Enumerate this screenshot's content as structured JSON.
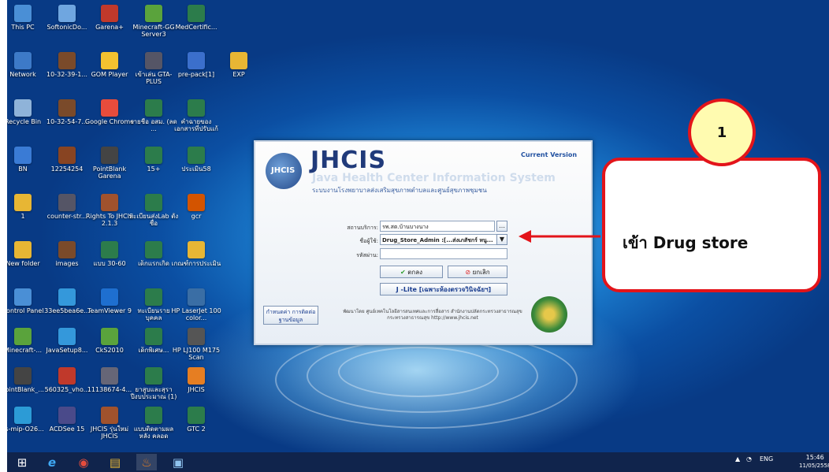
{
  "desktop_icons": [
    {
      "label": "This PC",
      "color": "#4a8fd6"
    },
    {
      "label": "SoftonicDo...",
      "color": "#6fa6e0"
    },
    {
      "label": "Garena+",
      "color": "#c0392b"
    },
    {
      "label": "Minecraft-GG Server3",
      "color": "#5aa33c"
    },
    {
      "label": "MedCertific...",
      "color": "#2c7c4b"
    },
    {
      "label": "Network",
      "color": "#3d7ac8"
    },
    {
      "label": "10-32-39-1...",
      "color": "#7a4a2a"
    },
    {
      "label": "GOM Player",
      "color": "#f2c230"
    },
    {
      "label": "เข้าเล่น GTA-PLUS",
      "color": "#556"
    },
    {
      "label": "pre-pack[1]",
      "color": "#3b6fcc"
    },
    {
      "label": "EXP",
      "color": "#e7b634"
    },
    {
      "label": "Recycle Bin",
      "color": "#8fb3d9"
    },
    {
      "label": "10-32-54-7...",
      "color": "#7a4a2a"
    },
    {
      "label": "Google Chrome",
      "color": "#e74c3c"
    },
    {
      "label": "รายชื่อ อสม. (ลด ...",
      "color": "#2c7c4b"
    },
    {
      "label": "คำฉายของ เอกสารที่ปรับแก้",
      "color": "#2c7c4b"
    },
    {
      "label": "BN",
      "color": "#3a7bd5"
    },
    {
      "label": "12254254",
      "color": "#884422"
    },
    {
      "label": "PointBlank Garena",
      "color": "#444"
    },
    {
      "label": "15+",
      "color": "#2c7c4b"
    },
    {
      "label": "ประเมิน58",
      "color": "#2c7c4b"
    },
    {
      "label": "1",
      "color": "#e7b634"
    },
    {
      "label": "counter-str...",
      "color": "#556"
    },
    {
      "label": "Rights To JHCIS 2.1.3",
      "color": "#a0522d"
    },
    {
      "label": "ทะเบียนส่งLab ตั้งชื่อ",
      "color": "#2c7c4b"
    },
    {
      "label": "gcr",
      "color": "#d35400"
    },
    {
      "label": "New folder",
      "color": "#e7b634"
    },
    {
      "label": "images",
      "color": "#7a4a2a"
    },
    {
      "label": "แบบ 30-60",
      "color": "#2c7c4b"
    },
    {
      "label": "เด็กแรกเกิด",
      "color": "#2c7c4b"
    },
    {
      "label": "เกณฑ์การประเมิน",
      "color": "#e7b634"
    },
    {
      "label": "Control Panel",
      "color": "#4a8fd6"
    },
    {
      "label": "33ee5bea6e...",
      "color": "#3498db"
    },
    {
      "label": "TeamViewer 9",
      "color": "#1e6fd0"
    },
    {
      "label": "ทะเบียนราย บุคคล",
      "color": "#2c7c4b"
    },
    {
      "label": "HP LaserJet 100 color...",
      "color": "#3a6ea5"
    },
    {
      "label": "Minecraft-...",
      "color": "#5aa33c"
    },
    {
      "label": "JavaSetup8...",
      "color": "#3498db"
    },
    {
      "label": "CkS2010",
      "color": "#5aa33c"
    },
    {
      "label": "เด็กพิเศษ...",
      "color": "#2c7c4b"
    },
    {
      "label": "HP LJ100 M175 Scan",
      "color": "#555"
    },
    {
      "label": "PointBlank_...",
      "color": "#444"
    },
    {
      "label": "560325_vho...",
      "color": "#c0392b"
    },
    {
      "label": "11138674-4...",
      "color": "#667"
    },
    {
      "label": "ยาสูบและสุรา ปีงบประมาณ (1)",
      "color": "#2c7c4b"
    },
    {
      "label": "JHCIS",
      "color": "#e67e22"
    },
    {
      "label": "ss-mip-O26...",
      "color": "#2c9bd6"
    },
    {
      "label": "ACDSee 15",
      "color": "#4a4a8a"
    },
    {
      "label": "JHCIS รุ่นใหม่ JHCIS",
      "color": "#a0522d"
    },
    {
      "label": "แบบติดตามผลหลัง คลอด",
      "color": "#2c7c4b"
    },
    {
      "label": "GTC 2",
      "color": "#2c7c4b"
    }
  ],
  "taskbar": {
    "icons": [
      "start-icon",
      "internet-explorer-icon",
      "chrome-icon",
      "file-explorer-icon",
      "java-icon",
      "app-window-icon"
    ],
    "language": "ENG",
    "time": "15:46",
    "date": "11/05/2558"
  },
  "jhcis": {
    "logo_text": "JHCIS",
    "title": "JHCIS",
    "subtitle": "Java Health Center Information System",
    "subtitle_thai": "ระบบงานโรงพยาบาลส่งเสริมสุขภาพตำบลและศูนย์สุขภาพชุมชน",
    "version_label": "Current Version",
    "service_label": "สถานบริการ:",
    "service_value": "รพ.สต.บ้านบางนาง",
    "user_label": "ชื่อผู้ใช้:",
    "user_value": "Drug_Store_Admin :[...ส่งเภสัชกร์ หนู...",
    "password_label": "รหัสผ่าน:",
    "password_value": "",
    "ok_label": "ตกลง",
    "cancel_label": "ยกเลิก",
    "jlite_label": "J -Lite [เฉพาะห้องตรวจวินิจฉัยฯ]",
    "standard_button_label": "กำหนดค่า การติดต่อฐานข้อมูล",
    "footer_text": "พัฒนาโดย ศูนย์เทคโนโลยีสารสนเทศและการสื่อสาร สำนักงานปลัดกระทรวงสาธารณสุข กระทรวงสาธารณสุข http://www.jhcis.net",
    "accent": "#203a7a"
  },
  "annotation": {
    "step_number": "1",
    "callout_text": "เข้า Drug store",
    "color": "#e3141a"
  }
}
